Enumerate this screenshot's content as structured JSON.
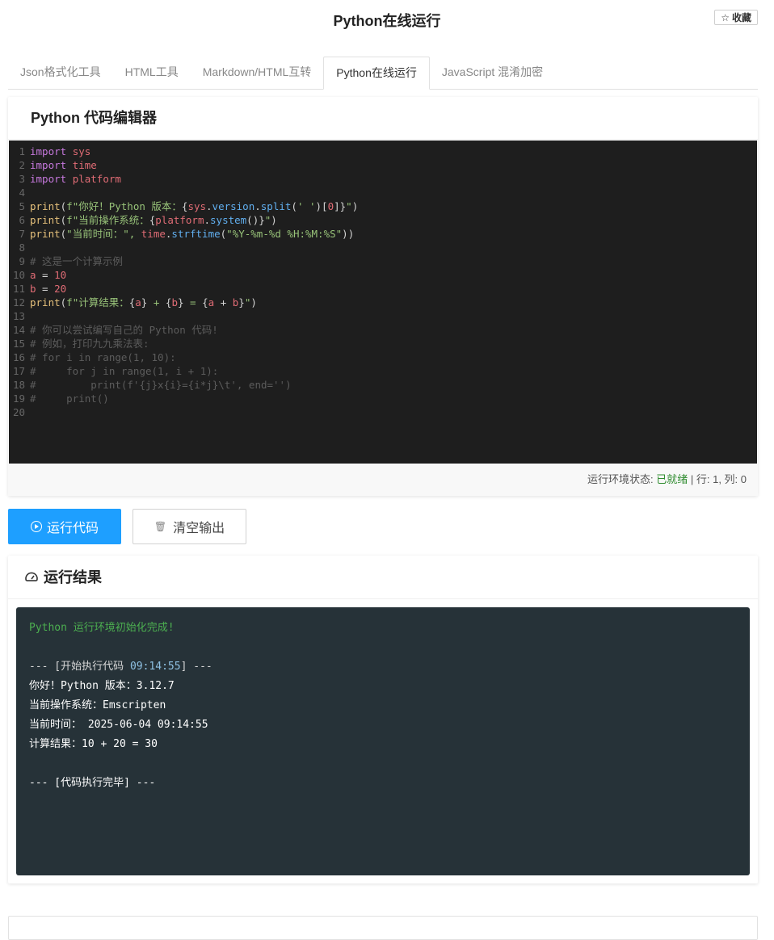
{
  "header": {
    "title": "Python在线运行",
    "favorite_label": "收藏"
  },
  "tabs": [
    {
      "label": "Json格式化工具"
    },
    {
      "label": "HTML工具"
    },
    {
      "label": "Markdown/HTML互转"
    },
    {
      "label": "Python在线运行"
    },
    {
      "label": "JavaScript 混淆加密"
    }
  ],
  "editor": {
    "title": "Python 代码编辑器",
    "line_numbers": [
      "1",
      "2",
      "3",
      "4",
      "5",
      "6",
      "7",
      "8",
      "9",
      "10",
      "11",
      "12",
      "13",
      "14",
      "15",
      "16",
      "17",
      "18",
      "19",
      "20"
    ],
    "code": [
      "import sys",
      "import time",
      "import platform",
      "",
      "print(f\"你好！Python 版本：{sys.version.split(' ')[0]}\")",
      "print(f\"当前操作系统：{platform.system()}\")",
      "print(\"当前时间：\", time.strftime(\"%Y-%m-%d %H:%M:%S\"))",
      "",
      "# 这是一个计算示例",
      "a = 10",
      "b = 20",
      "print(f\"计算结果：{a} + {b} = {a + b}\")",
      "",
      "# 你可以尝试编写自己的 Python 代码!",
      "# 例如，打印九九乘法表:",
      "# for i in range(1, 10):",
      "#     for j in range(1, i + 1):",
      "#         print(f'{j}x{i}={i*j}\\t', end='')",
      "#     print()",
      ""
    ],
    "status_label": "运行环境状态: ",
    "status_value": "已就绪",
    "cursor_info": " | 行: 1, 列: 0"
  },
  "actions": {
    "run_label": "运行代码",
    "clear_label": "清空输出"
  },
  "result": {
    "title": "运行结果",
    "init_message": "Python 运行环境初始化完成!",
    "start_prefix": "--- [开始执行代码 ",
    "start_time": "09:14:55",
    "start_suffix": "] ---",
    "lines": [
      "你好！Python 版本：3.12.7",
      "当前操作系统：Emscripten",
      "当前时间： 2025-06-04 09:14:55",
      "计算结果：10 + 20 = 30"
    ],
    "end_message": "--- [代码执行完毕] ---"
  },
  "colors": {
    "accent": "#1e9fff",
    "ready": "#2e8b2e",
    "editor_bg": "#1e1e1e",
    "output_bg": "#263238"
  }
}
